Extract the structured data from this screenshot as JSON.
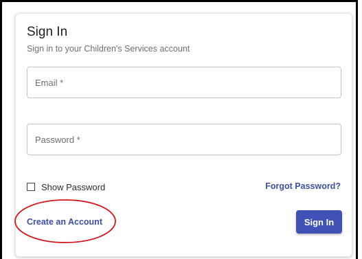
{
  "card": {
    "title": "Sign In",
    "subtitle": "Sign in to your Children's Services account"
  },
  "form": {
    "email_placeholder": "Email *",
    "password_placeholder": "Password *",
    "show_password_label": "Show Password",
    "show_password_checked": false
  },
  "links": {
    "forgot_password": "Forgot Password?",
    "create_account": "Create an Account"
  },
  "actions": {
    "sign_in_label": "Sign In"
  },
  "colors": {
    "primary": "#3f51b5",
    "link": "#3c4fa3",
    "annotation_circle": "#d4141c"
  }
}
